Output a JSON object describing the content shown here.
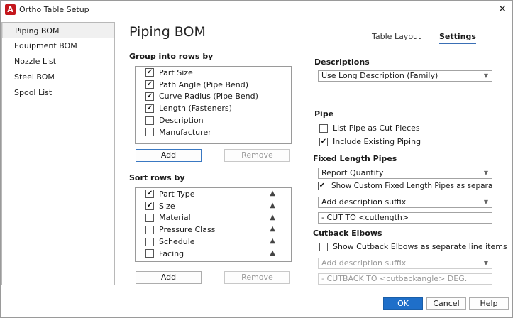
{
  "window": {
    "title": "Ortho Table Setup",
    "app_icon_letter": "A",
    "close_glyph": "✕"
  },
  "sidebar": {
    "items": [
      {
        "label": "Piping BOM"
      },
      {
        "label": "Equipment BOM"
      },
      {
        "label": "Nozzle List"
      },
      {
        "label": "Steel BOM"
      },
      {
        "label": "Spool List"
      }
    ]
  },
  "main": {
    "title": "Piping BOM",
    "tabs": [
      {
        "label": "Table Layout"
      },
      {
        "label": "Settings"
      }
    ]
  },
  "group_rows": {
    "label": "Group into rows by",
    "items": [
      {
        "label": "Part Size",
        "checked": true
      },
      {
        "label": "Path Angle (Pipe Bend)",
        "checked": true
      },
      {
        "label": "Curve Radius (Pipe Bend)",
        "checked": true
      },
      {
        "label": "Length (Fasteners)",
        "checked": true
      },
      {
        "label": "Description",
        "checked": false
      },
      {
        "label": "Manufacturer",
        "checked": false
      }
    ],
    "add_label": "Add",
    "remove_label": "Remove"
  },
  "sort_rows": {
    "label": "Sort rows by",
    "items": [
      {
        "label": "Part Type",
        "checked": true
      },
      {
        "label": "Size",
        "checked": true
      },
      {
        "label": "Material",
        "checked": false
      },
      {
        "label": "Pressure Class",
        "checked": false
      },
      {
        "label": "Schedule",
        "checked": false
      },
      {
        "label": "Facing",
        "checked": false
      }
    ],
    "add_label": "Add",
    "remove_label": "Remove",
    "arrow_glyph": "▲"
  },
  "descriptions": {
    "label": "Descriptions",
    "selected": "Use Long Description (Family)"
  },
  "pipe": {
    "label": "Pipe",
    "list_cut": {
      "label": "List Pipe as Cut Pieces",
      "checked": false
    },
    "include_existing": {
      "label": "Include Existing Piping",
      "checked": true
    }
  },
  "fixed_length": {
    "label": "Fixed Length Pipes",
    "quantity_select": "Report Quantity",
    "show_custom": {
      "label": "Show Custom Fixed Length Pipes as separate line items",
      "checked": true
    },
    "suffix_select": "Add description suffix",
    "suffix_text": "- CUT TO <cutlength>"
  },
  "cutback": {
    "label": "Cutback Elbows",
    "show_cutback": {
      "label": "Show Cutback Elbows as separate line items",
      "checked": false
    },
    "suffix_select": "Add description suffix",
    "suffix_text": "- CUTBACK TO <cutbackangle> DEG."
  },
  "footer": {
    "ok": "OK",
    "cancel": "Cancel",
    "help": "Help"
  },
  "colors": {
    "accent": "#1f6fc9",
    "brand": "#c4161c"
  }
}
